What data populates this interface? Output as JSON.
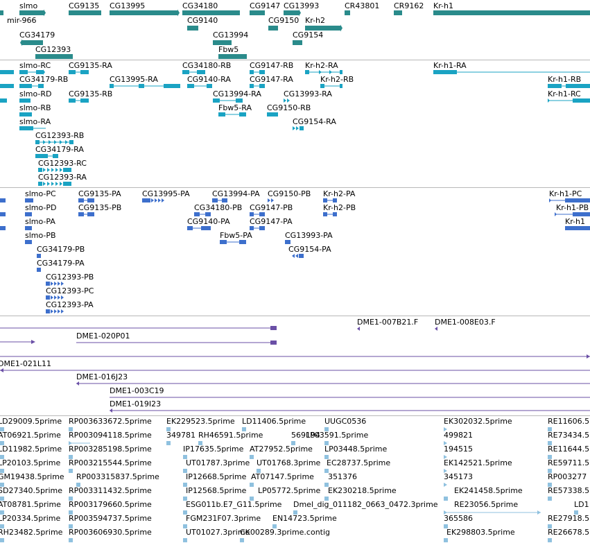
{
  "colors": {
    "gene": "#2a8b8b",
    "mrna": "#1aa3c3",
    "protein": "#3d6fcc",
    "bac": "#6a4fa6",
    "est": "#8fc1df",
    "separator": "#b8b8b8"
  },
  "tracks": [
    {
      "id": "genes",
      "features": [
        {
          "label": "slmo"
        },
        {
          "label": "mir-966"
        },
        {
          "label": "CG9135"
        },
        {
          "label": "CG13995"
        },
        {
          "label": "CG34180"
        },
        {
          "label": "CG9147"
        },
        {
          "label": "CG13993"
        },
        {
          "label": "CR43801"
        },
        {
          "label": "CR9162"
        },
        {
          "label": "Kr-h1"
        },
        {
          "label": "CG9140"
        },
        {
          "label": "CG9150"
        },
        {
          "label": "Kr-h2"
        },
        {
          "label": "CG34179"
        },
        {
          "label": "CG13994"
        },
        {
          "label": "CG9154"
        },
        {
          "label": "Fbw5"
        },
        {
          "label": "CG12393"
        }
      ]
    },
    {
      "id": "mrna",
      "features": [
        {
          "label": "slmo-RC"
        },
        {
          "label": "CG9135-RA"
        },
        {
          "label": "CG34180-RB"
        },
        {
          "label": "CG9147-RB"
        },
        {
          "label": "Kr-h2-RA"
        },
        {
          "label": "Kr-h1-RA"
        },
        {
          "label": "CG34179-RB"
        },
        {
          "label": "CG13995-RA"
        },
        {
          "label": "CG9140-RA"
        },
        {
          "label": "CG9147-RA"
        },
        {
          "label": "Kr-h2-RB"
        },
        {
          "label": "Kr-h1-RB"
        },
        {
          "label": "slmo-RD"
        },
        {
          "label": "CG9135-RB"
        },
        {
          "label": "CG13994-RA"
        },
        {
          "label": "CG13993-RA"
        },
        {
          "label": "Kr-h1-RC"
        },
        {
          "label": "slmo-RB"
        },
        {
          "label": "Fbw5-RA"
        },
        {
          "label": "CG9150-RB"
        },
        {
          "label": "slmo-RA"
        },
        {
          "label": "CG9154-RA"
        },
        {
          "label": "CG12393-RB"
        },
        {
          "label": "CG34179-RA"
        },
        {
          "label": "CG12393-RC"
        },
        {
          "label": "CG12393-RA"
        }
      ]
    },
    {
      "id": "proteins",
      "features": [
        {
          "label": "slmo-PC"
        },
        {
          "label": "CG9135-PA"
        },
        {
          "label": "CG13995-PA"
        },
        {
          "label": "CG13994-PA"
        },
        {
          "label": "CG9150-PB"
        },
        {
          "label": "Kr-h2-PA"
        },
        {
          "label": "Kr-h1-PC"
        },
        {
          "label": "slmo-PD"
        },
        {
          "label": "CG9135-PB"
        },
        {
          "label": "CG34180-PB"
        },
        {
          "label": "CG9147-PB"
        },
        {
          "label": "Kr-h2-PB"
        },
        {
          "label": "Kr-h1-PB"
        },
        {
          "label": "slmo-PA"
        },
        {
          "label": "CG9140-PA"
        },
        {
          "label": "CG9147-PA"
        },
        {
          "label": "Kr-h1"
        },
        {
          "label": "slmo-PB"
        },
        {
          "label": "Fbw5-PA"
        },
        {
          "label": "CG13993-PA"
        },
        {
          "label": "CG34179-PB"
        },
        {
          "label": "CG9154-PA"
        },
        {
          "label": "CG34179-PA"
        },
        {
          "label": "CG12393-PB"
        },
        {
          "label": "CG12393-PC"
        },
        {
          "label": "CG12393-PA"
        }
      ]
    },
    {
      "id": "bac",
      "features": [
        {
          "label": "DME1-007B21.F"
        },
        {
          "label": "DME1-008E03.F"
        },
        {
          "label": "DME1-020P01"
        },
        {
          "label": "DME1-021L11"
        },
        {
          "label": "DME1-016J23"
        },
        {
          "label": "DME1-003C19"
        },
        {
          "label": "DME1-019I23"
        }
      ]
    },
    {
      "id": "est",
      "features": [
        {
          "label": "LD29009.5prime"
        },
        {
          "label": "RP003633672.5prime"
        },
        {
          "label": "EK229523.5prime"
        },
        {
          "label": "LD11406.5prime"
        },
        {
          "label": "UUGC0536"
        },
        {
          "label": "EK302032.5prime"
        },
        {
          "label": "RE11606.5"
        },
        {
          "label": "AT06921.5prime"
        },
        {
          "label": "RP003094118.5prime"
        },
        {
          "label": "349781"
        },
        {
          "label": "RH46591.5prime"
        },
        {
          "label": "569194"
        },
        {
          "label": "LP03591.5prime"
        },
        {
          "label": "499821"
        },
        {
          "label": "RE73434.5"
        },
        {
          "label": "LD11982.5prime"
        },
        {
          "label": "RP003285198.5prime"
        },
        {
          "label": "IP17635.5prime"
        },
        {
          "label": "AT27952.5prime"
        },
        {
          "label": "LP03448.5prime"
        },
        {
          "label": "194515"
        },
        {
          "label": "RE11644.5"
        },
        {
          "label": "LP20103.5prime"
        },
        {
          "label": "RP003215544.5prime"
        },
        {
          "label": "UT01787.3prime"
        },
        {
          "label": "UT01768.3prime"
        },
        {
          "label": "EC28737.5prime"
        },
        {
          "label": "EK142521.5prime"
        },
        {
          "label": "RE59711.5"
        },
        {
          "label": "GM19438.5prime"
        },
        {
          "label": "RP003315837.5prime"
        },
        {
          "label": "IP12668.5prime"
        },
        {
          "label": "AT07147.5prime"
        },
        {
          "label": "351376"
        },
        {
          "label": "345173"
        },
        {
          "label": "RP003277"
        },
        {
          "label": "SD27340.5prime"
        },
        {
          "label": "RP003311432.5prime"
        },
        {
          "label": "IP12568.5prime"
        },
        {
          "label": "LP05772.5prime"
        },
        {
          "label": "EK230218.5prime"
        },
        {
          "label": "EK241458.5prime"
        },
        {
          "label": "RE57338.5"
        },
        {
          "label": "AT08781.5prime"
        },
        {
          "label": "RP003179660.5prime"
        },
        {
          "label": "ESG011b.E7_G11.5prime"
        },
        {
          "label": "Dmel_dig_011182_0663_0472.3prime"
        },
        {
          "label": "RE23056.5prime"
        },
        {
          "label": "LD1"
        },
        {
          "label": "LP20334.5prime"
        },
        {
          "label": "RP003594737.5prime"
        },
        {
          "label": "FGM231F07.3prime"
        },
        {
          "label": "EN14723.5prime"
        },
        {
          "label": "365586"
        },
        {
          "label": "RE27918.5"
        },
        {
          "label": "RH23482.5prime"
        },
        {
          "label": "RP003606930.5prime"
        },
        {
          "label": "UT01027.3prime"
        },
        {
          "label": "CK00289.3prime.contig"
        },
        {
          "label": "EK298803.5prime"
        },
        {
          "label": "RE26678.5"
        }
      ]
    }
  ]
}
